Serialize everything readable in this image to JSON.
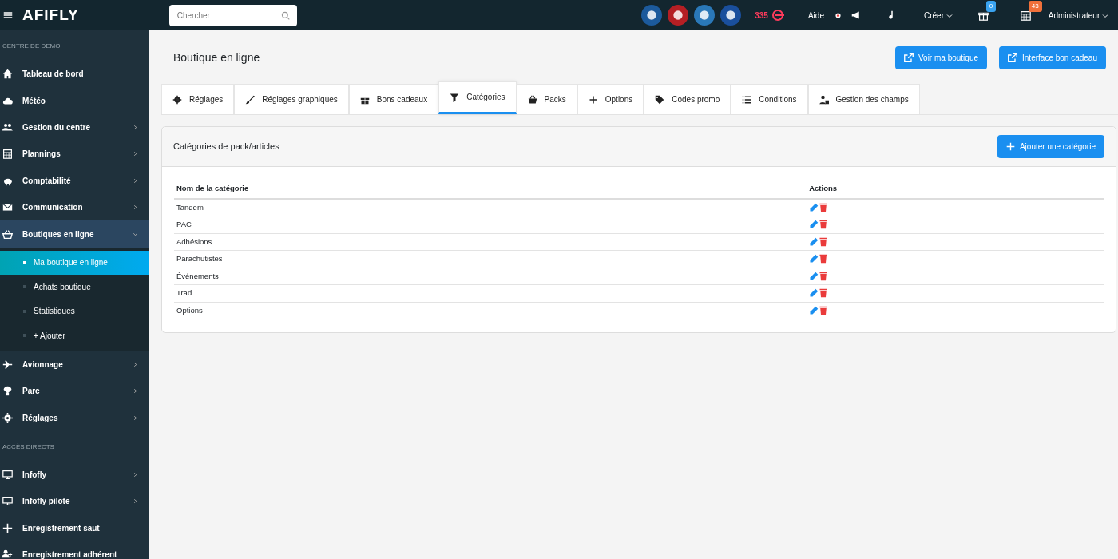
{
  "topbar": {
    "logo": "AFIFLY",
    "search": {
      "placeholder": "Chercher"
    },
    "counter": "335",
    "help": "Aide",
    "create": "Créer",
    "gift_badge": "0",
    "calendar_badge": "43",
    "user": "Administrateur"
  },
  "sidebar": [
    {
      "kind": "section",
      "label": "CENTRE DE DEMO"
    },
    {
      "kind": "item",
      "label": "Tableau de bord",
      "has_arrow": false,
      "expanded": false,
      "selected": false
    },
    {
      "kind": "item",
      "label": "Météo",
      "has_arrow": false,
      "expanded": false,
      "selected": false
    },
    {
      "kind": "item",
      "label": "Gestion du centre",
      "has_arrow": true,
      "expanded": false,
      "selected": false
    },
    {
      "kind": "item",
      "label": "Plannings",
      "has_arrow": true,
      "expanded": false,
      "selected": false
    },
    {
      "kind": "item",
      "label": "Comptabilité",
      "has_arrow": true,
      "expanded": false,
      "selected": false
    },
    {
      "kind": "item",
      "label": "Communication",
      "has_arrow": true,
      "expanded": false,
      "selected": false
    },
    {
      "kind": "item",
      "label": "Boutiques en ligne",
      "has_arrow": true,
      "expanded": true,
      "selected": false,
      "children": [
        {
          "label": "Ma boutique en ligne",
          "selected": true
        },
        {
          "label": "Achats boutique",
          "selected": false
        },
        {
          "label": "Statistiques",
          "selected": false
        },
        {
          "label": "+ Ajouter",
          "selected": false
        }
      ]
    },
    {
      "kind": "item",
      "label": "Avionnage",
      "has_arrow": true,
      "expanded": false,
      "selected": false
    },
    {
      "kind": "item",
      "label": "Parc",
      "has_arrow": true,
      "expanded": false,
      "selected": false
    },
    {
      "kind": "item",
      "label": "Réglages",
      "has_arrow": true,
      "expanded": false,
      "selected": false
    },
    {
      "kind": "section",
      "label": "ACCÈS DIRECTS"
    },
    {
      "kind": "item",
      "label": "Infofly",
      "has_arrow": true,
      "expanded": false,
      "selected": false
    },
    {
      "kind": "item",
      "label": "Infofly pilote",
      "has_arrow": true,
      "expanded": false,
      "selected": false
    },
    {
      "kind": "item",
      "label": "Enregistrement saut",
      "has_arrow": false,
      "expanded": false,
      "selected": false
    },
    {
      "kind": "item",
      "label": "Enregistrement adhérent",
      "has_arrow": false,
      "expanded": false,
      "selected": false
    }
  ],
  "page": {
    "title": "Boutique en ligne",
    "buttons": [
      "Voir ma boutique",
      "Interface bon cadeau"
    ]
  },
  "tabs": [
    {
      "label": "Réglages",
      "selected": false
    },
    {
      "label": "Réglages graphiques",
      "selected": false
    },
    {
      "label": "Bons cadeaux",
      "selected": false
    },
    {
      "label": "Catégories",
      "selected": true
    },
    {
      "label": "Packs",
      "selected": false
    },
    {
      "label": "Options",
      "selected": false
    },
    {
      "label": "Codes promo",
      "selected": false
    },
    {
      "label": "Conditions",
      "selected": false
    },
    {
      "label": "Gestion des champs",
      "selected": false
    }
  ],
  "card": {
    "title": "Catégories de pack/articles",
    "add_button": "Ajouter une catégorie",
    "columns": [
      "Nom de la catégorie",
      "Actions"
    ],
    "rows": [
      "Tandem",
      "PAC",
      "Adhésions",
      "Parachutistes",
      "Événements",
      "Trad",
      "Options"
    ]
  }
}
